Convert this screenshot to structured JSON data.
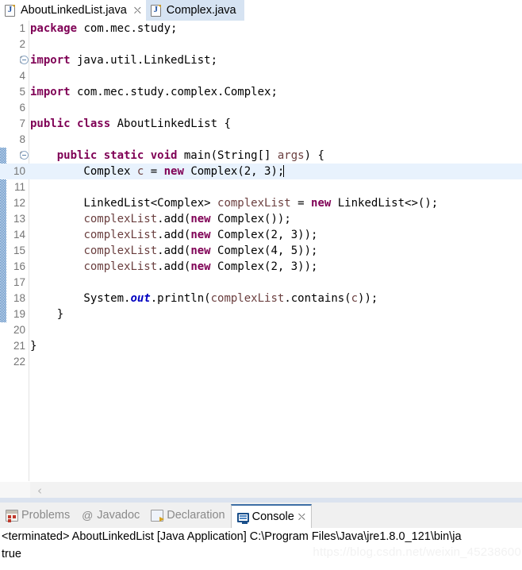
{
  "editor_tabs": [
    {
      "label": "AboutLinkedList.java",
      "icon": "java-file-icon",
      "active": true,
      "closeable": true
    },
    {
      "label": "Complex.java",
      "icon": "java-file-icon",
      "active": false,
      "closeable": false
    }
  ],
  "editor": {
    "highlighted_line": 10,
    "change_marker_lines": [
      9,
      19
    ],
    "fold_lines": [
      3,
      9
    ],
    "lines": [
      {
        "n": "1",
        "tokens": [
          {
            "t": "package",
            "c": "kw"
          },
          {
            "t": " com.mec.study;",
            "c": ""
          }
        ]
      },
      {
        "n": "2",
        "tokens": []
      },
      {
        "n": "3",
        "tokens": [
          {
            "t": "import",
            "c": "kw"
          },
          {
            "t": " java.util.LinkedList;",
            "c": ""
          }
        ]
      },
      {
        "n": "4",
        "tokens": []
      },
      {
        "n": "5",
        "tokens": [
          {
            "t": "import",
            "c": "kw"
          },
          {
            "t": " com.mec.study.complex.Complex;",
            "c": ""
          }
        ]
      },
      {
        "n": "6",
        "tokens": []
      },
      {
        "n": "7",
        "tokens": [
          {
            "t": "public class",
            "c": "kw"
          },
          {
            "t": " AboutLinkedList {",
            "c": ""
          }
        ]
      },
      {
        "n": "8",
        "tokens": []
      },
      {
        "n": "9",
        "tokens": [
          {
            "t": "    ",
            "c": ""
          },
          {
            "t": "public static void",
            "c": "kw"
          },
          {
            "t": " main(String[] ",
            "c": ""
          },
          {
            "t": "args",
            "c": "loc"
          },
          {
            "t": ") {",
            "c": ""
          }
        ]
      },
      {
        "n": "10",
        "tokens": [
          {
            "t": "        Complex ",
            "c": ""
          },
          {
            "t": "c",
            "c": "loc"
          },
          {
            "t": " = ",
            "c": ""
          },
          {
            "t": "new",
            "c": "kw"
          },
          {
            "t": " Complex(2, 3);",
            "c": ""
          }
        ]
      },
      {
        "n": "11",
        "tokens": []
      },
      {
        "n": "12",
        "tokens": [
          {
            "t": "        LinkedList<Complex> ",
            "c": ""
          },
          {
            "t": "complexList",
            "c": "loc"
          },
          {
            "t": " = ",
            "c": ""
          },
          {
            "t": "new",
            "c": "kw"
          },
          {
            "t": " LinkedList<>();",
            "c": ""
          }
        ]
      },
      {
        "n": "13",
        "tokens": [
          {
            "t": "        ",
            "c": ""
          },
          {
            "t": "complexList",
            "c": "loc"
          },
          {
            "t": ".add(",
            "c": ""
          },
          {
            "t": "new",
            "c": "kw"
          },
          {
            "t": " Complex());",
            "c": ""
          }
        ]
      },
      {
        "n": "14",
        "tokens": [
          {
            "t": "        ",
            "c": ""
          },
          {
            "t": "complexList",
            "c": "loc"
          },
          {
            "t": ".add(",
            "c": ""
          },
          {
            "t": "new",
            "c": "kw"
          },
          {
            "t": " Complex(2, 3));",
            "c": ""
          }
        ]
      },
      {
        "n": "15",
        "tokens": [
          {
            "t": "        ",
            "c": ""
          },
          {
            "t": "complexList",
            "c": "loc"
          },
          {
            "t": ".add(",
            "c": ""
          },
          {
            "t": "new",
            "c": "kw"
          },
          {
            "t": " Complex(4, 5));",
            "c": ""
          }
        ]
      },
      {
        "n": "16",
        "tokens": [
          {
            "t": "        ",
            "c": ""
          },
          {
            "t": "complexList",
            "c": "loc"
          },
          {
            "t": ".add(",
            "c": ""
          },
          {
            "t": "new",
            "c": "kw"
          },
          {
            "t": " Complex(2, 3));",
            "c": ""
          }
        ]
      },
      {
        "n": "17",
        "tokens": []
      },
      {
        "n": "18",
        "tokens": [
          {
            "t": "        System.",
            "c": ""
          },
          {
            "t": "out",
            "c": "stat"
          },
          {
            "t": ".println(",
            "c": ""
          },
          {
            "t": "complexList",
            "c": "loc"
          },
          {
            "t": ".contains(",
            "c": ""
          },
          {
            "t": "c",
            "c": "loc"
          },
          {
            "t": "));",
            "c": ""
          }
        ]
      },
      {
        "n": "19",
        "tokens": [
          {
            "t": "    }",
            "c": ""
          }
        ]
      },
      {
        "n": "20",
        "tokens": []
      },
      {
        "n": "21",
        "tokens": [
          {
            "t": "}",
            "c": ""
          }
        ]
      },
      {
        "n": "22",
        "tokens": []
      }
    ]
  },
  "editor_scrollbar": {
    "left_arrow_glyph": "‹"
  },
  "view_tabs": [
    {
      "label": "Problems",
      "icon": "problems-icon",
      "active": false,
      "closeable": false
    },
    {
      "label": "Javadoc",
      "icon": "javadoc-icon",
      "active": false,
      "closeable": false
    },
    {
      "label": "Declaration",
      "icon": "declaration-icon",
      "active": false,
      "closeable": false
    },
    {
      "label": "Console",
      "icon": "console-icon",
      "active": true,
      "closeable": true
    }
  ],
  "console": {
    "status_line": "<terminated> AboutLinkedList [Java Application] C:\\Program Files\\Java\\jre1.8.0_121\\bin\\ja",
    "output_line": "true",
    "watermark": "https://blog.csdn.net/weixin_45238600"
  },
  "colors": {
    "keyword": "#7f0055",
    "local_var": "#6a3e3e",
    "static_field": "#0000c0",
    "highlight_line": "#e8f2fd",
    "tab_inactive": "#d6e3f2",
    "change_marker": "#2f6fb5"
  }
}
